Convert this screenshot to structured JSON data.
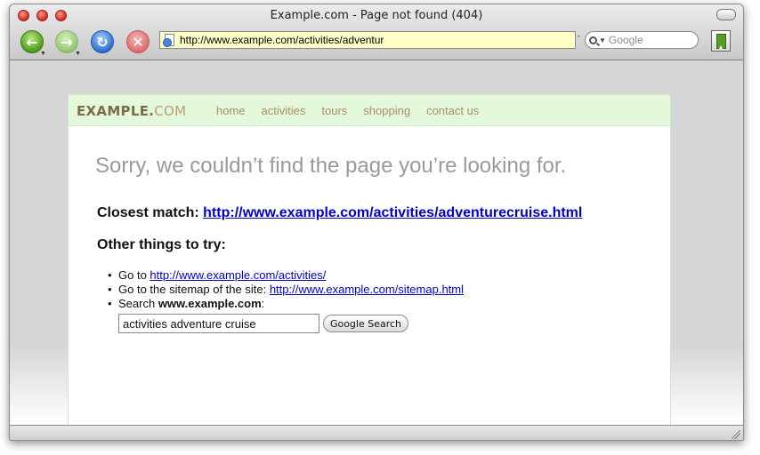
{
  "window": {
    "title": "Example.com - Page not found (404)"
  },
  "toolbar": {
    "url": "http://www.example.com/activities/adventur",
    "search_placeholder": "Google",
    "icons": [
      "back-icon",
      "forward-icon",
      "reload-icon",
      "stop-icon",
      "site-icon",
      "search-icon",
      "bookmark-icon"
    ]
  },
  "site": {
    "logo_main": "EXAMPLE.",
    "logo_suffix": "COM",
    "nav": [
      "home",
      "activities",
      "tours",
      "shopping",
      "contact us"
    ]
  },
  "page": {
    "heading": "Sorry, we couldn’t find the page you’re looking for.",
    "closest_label": "Closest match:",
    "closest_link": "http://www.example.com/activities/adventurecruise.html",
    "other_heading": "Other things to try:",
    "items": [
      {
        "prefix": "Go to ",
        "link": "http://www.example.com/activities/"
      },
      {
        "prefix": "Go to the sitemap of the site: ",
        "link": "http://www.example.com/sitemap.html"
      },
      {
        "prefix": "Search ",
        "bold": "www.example.com",
        "suffix": ":"
      }
    ],
    "search_value": "activities adventure cruise",
    "search_button": "Google Search"
  },
  "colors": {
    "nav_bg": "#e4f8dc",
    "link": "#0000cc",
    "url_bar": "#ffffc6"
  }
}
